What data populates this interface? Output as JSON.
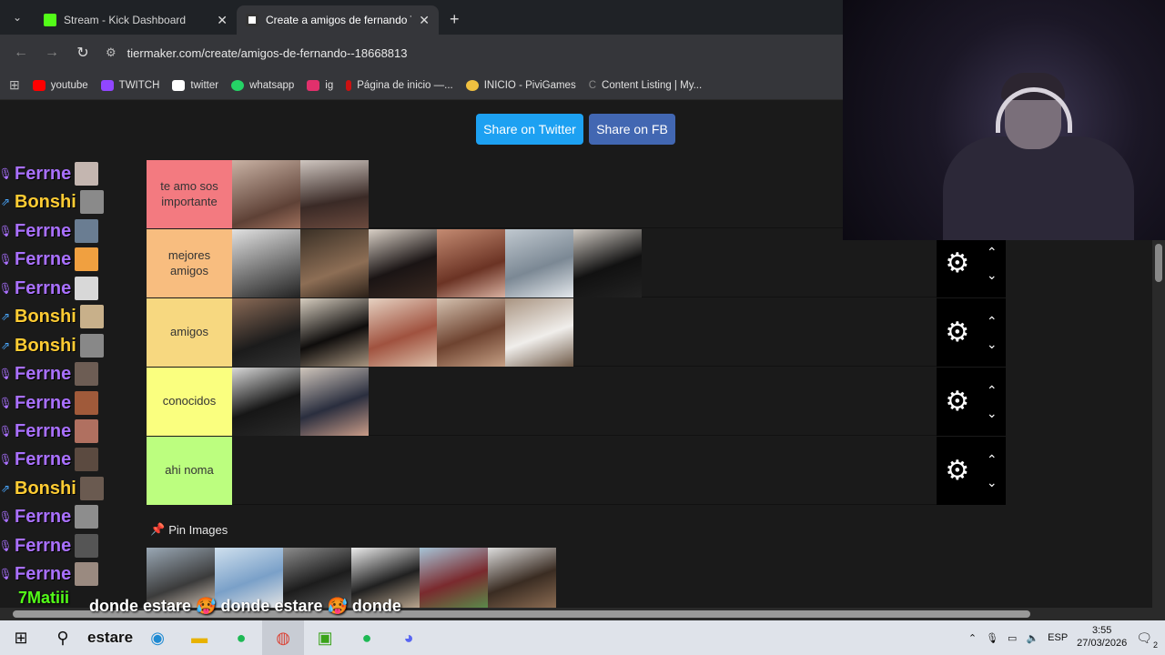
{
  "browser": {
    "tabs": [
      {
        "title": "Stream - Kick Dashboard",
        "active": false,
        "favicon_color": "#53fc18"
      },
      {
        "title": "Create a amigos de fernando Ti",
        "active": true,
        "favicon_color": "#ffffff"
      }
    ],
    "url": "tiermaker.com/create/amigos-de-fernando--18668813",
    "bookmarks": [
      {
        "label": "youtube",
        "color": "#ff0000"
      },
      {
        "label": "TWITCH",
        "color": "#9146ff"
      },
      {
        "label": "twitter",
        "color": "#ffffff"
      },
      {
        "label": "whatsapp",
        "color": "#25d366"
      },
      {
        "label": "ig",
        "color": "#e1306c"
      },
      {
        "label": "Página de inicio —...",
        "color": "#cc1111"
      },
      {
        "label": "INICIO - PiviGames",
        "color": "#f0c040"
      },
      {
        "label": "Content Listing | My...",
        "color": "#888888"
      }
    ]
  },
  "page": {
    "share_twitter": "Share on Twitter",
    "share_fb": "Share on FB",
    "pin_label": "Pin Images",
    "tiers": [
      {
        "label": "te amo sos importante",
        "color": "#f37a80",
        "images": 2,
        "controls": false
      },
      {
        "label": "mejores amigos",
        "color": "#f8bd7f",
        "images": 6,
        "controls": true
      },
      {
        "label": "amigos",
        "color": "#f7d880",
        "images": 5,
        "controls": true
      },
      {
        "label": "conocidos",
        "color": "#faff7f",
        "images": 2,
        "controls": true
      },
      {
        "label": "ahi noma",
        "color": "#bcfe7f",
        "images": 0,
        "controls": true
      }
    ],
    "pool_images": 6
  },
  "chat": {
    "messages": [
      {
        "name": "Ferrne",
        "color": "#a970ff",
        "badge": "mic"
      },
      {
        "name": "Bonshi",
        "color": "#ffcc33",
        "badge": "kick"
      },
      {
        "name": "Ferrne",
        "color": "#a970ff",
        "badge": "mic"
      },
      {
        "name": "Ferrne",
        "color": "#a970ff",
        "badge": "mic"
      },
      {
        "name": "Ferrne",
        "color": "#a970ff",
        "badge": "mic"
      },
      {
        "name": "Bonshi",
        "color": "#ffcc33",
        "badge": "kick"
      },
      {
        "name": "Bonshi",
        "color": "#ffcc33",
        "badge": "kick"
      },
      {
        "name": "Ferrne",
        "color": "#a970ff",
        "badge": "mic"
      },
      {
        "name": "Ferrne",
        "color": "#a970ff",
        "badge": "mic"
      },
      {
        "name": "Ferrne",
        "color": "#a970ff",
        "badge": "mic"
      },
      {
        "name": "Ferrne",
        "color": "#a970ff",
        "badge": "mic"
      },
      {
        "name": "Bonshi",
        "color": "#ffcc33",
        "badge": "kick"
      },
      {
        "name": "Ferrne",
        "color": "#a970ff",
        "badge": "mic"
      },
      {
        "name": "Ferrne",
        "color": "#a970ff",
        "badge": "mic"
      },
      {
        "name": "Ferrne",
        "color": "#a970ff",
        "badge": "mic"
      }
    ],
    "last_name": "7Matiii",
    "last_text": "donde estare 🥵 donde estare 🥵 donde",
    "taskbar_overflow": "estare"
  },
  "taskbar": {
    "lang": "ESP",
    "time": "3:55",
    "date": "27/03/2026",
    "notif_count": "2"
  }
}
